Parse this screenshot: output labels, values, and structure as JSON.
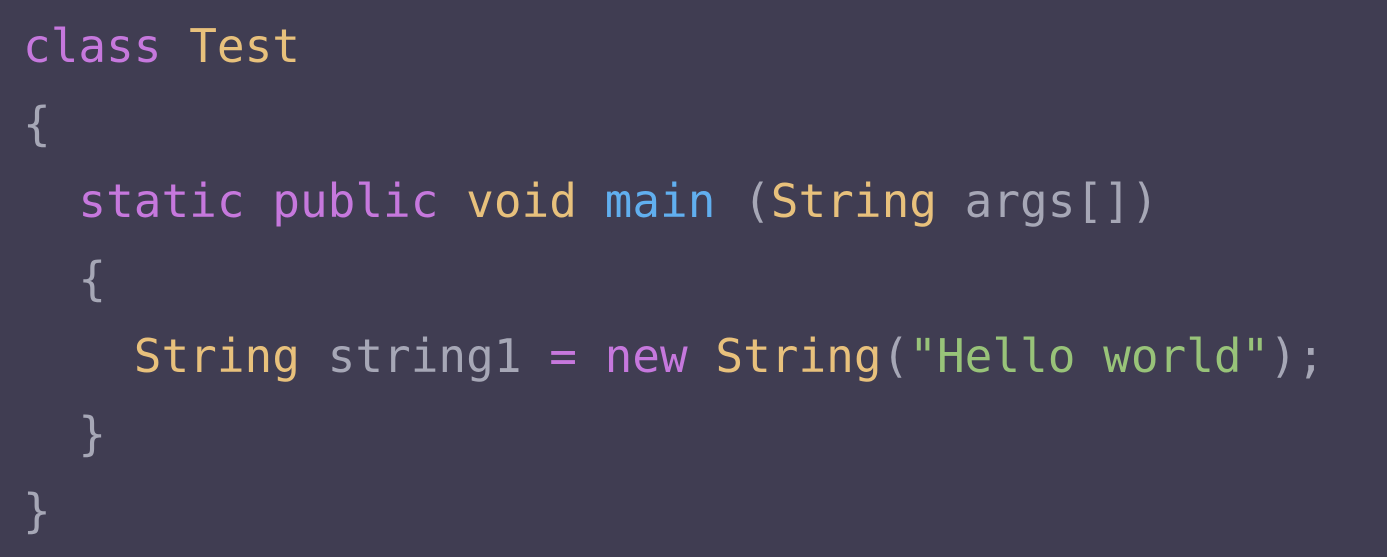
{
  "theme": {
    "background": "#403d52",
    "keyword": "#c678dd",
    "type": "#e8c17c",
    "function": "#61afef",
    "plain": "#a6a7b6",
    "string": "#98c379"
  },
  "code_lines": [
    {
      "indent": "",
      "tokens": [
        {
          "text": "class",
          "kind": "keyword"
        },
        {
          "text": " ",
          "kind": "plain"
        },
        {
          "text": "Test",
          "kind": "type"
        }
      ]
    },
    {
      "indent": "",
      "tokens": [
        {
          "text": "{",
          "kind": "plain"
        }
      ]
    },
    {
      "indent": "  ",
      "tokens": [
        {
          "text": "static",
          "kind": "keyword"
        },
        {
          "text": " ",
          "kind": "plain"
        },
        {
          "text": "public",
          "kind": "keyword"
        },
        {
          "text": " ",
          "kind": "plain"
        },
        {
          "text": "void",
          "kind": "type"
        },
        {
          "text": " ",
          "kind": "plain"
        },
        {
          "text": "main",
          "kind": "function"
        },
        {
          "text": " (",
          "kind": "plain"
        },
        {
          "text": "String",
          "kind": "type"
        },
        {
          "text": " args[])",
          "kind": "plain"
        }
      ]
    },
    {
      "indent": "  ",
      "tokens": [
        {
          "text": "{",
          "kind": "plain"
        }
      ]
    },
    {
      "indent": "    ",
      "tokens": [
        {
          "text": "String",
          "kind": "type"
        },
        {
          "text": " string1 ",
          "kind": "plain"
        },
        {
          "text": "=",
          "kind": "keyword"
        },
        {
          "text": " ",
          "kind": "plain"
        },
        {
          "text": "new",
          "kind": "keyword"
        },
        {
          "text": " ",
          "kind": "plain"
        },
        {
          "text": "String",
          "kind": "type"
        },
        {
          "text": "(",
          "kind": "plain"
        },
        {
          "text": "\"Hello world\"",
          "kind": "string"
        },
        {
          "text": ");",
          "kind": "plain"
        }
      ]
    },
    {
      "indent": "  ",
      "tokens": [
        {
          "text": "}",
          "kind": "plain"
        }
      ]
    },
    {
      "indent": "",
      "tokens": [
        {
          "text": "}",
          "kind": "plain"
        }
      ]
    }
  ]
}
